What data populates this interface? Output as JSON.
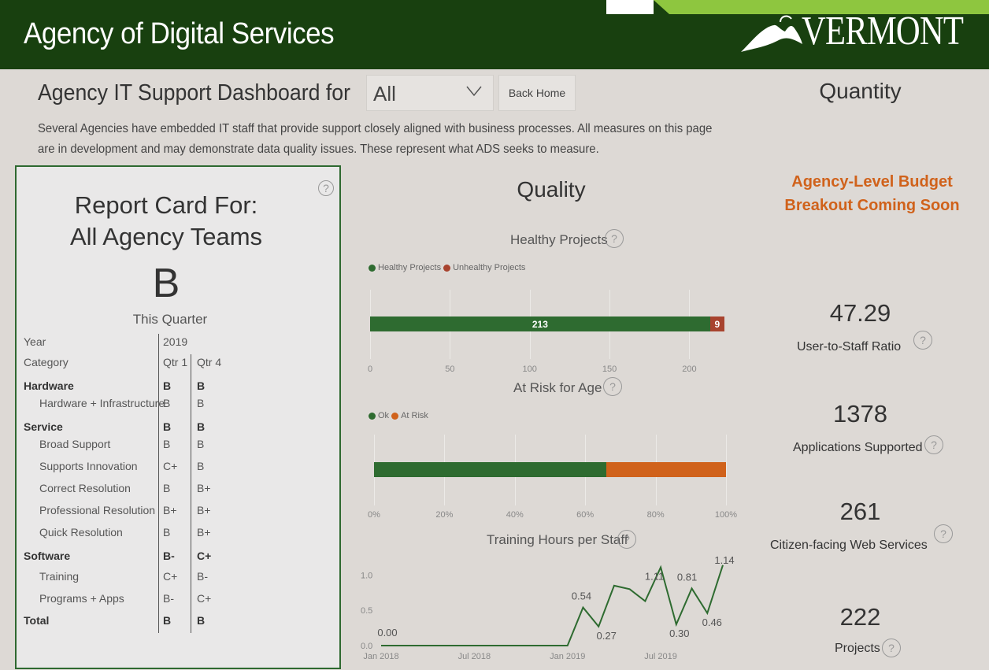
{
  "header": {
    "title": "Agency of Digital Services",
    "logo_text": "VERMONT"
  },
  "toolbar": {
    "dashboard_title": "Agency IT Support Dashboard for",
    "agency_select_value": "All",
    "back_button_label": "Back Home"
  },
  "description": "Several Agencies have embedded IT staff that provide support closely aligned with business processes. All measures on this page are in development and may demonstrate data quality issues. These represent what ADS seeks to measure.",
  "report_card": {
    "title_line1": "Report Card For:",
    "title_line2": "All Agency Teams",
    "grade": "B",
    "period_label": "This Quarter",
    "year_label": "Year",
    "year_value": "2019",
    "category_label": "Category",
    "quarters": [
      "Qtr 1",
      "Qtr 4"
    ],
    "rows": [
      {
        "name": "Hardware",
        "q1": "B",
        "q4": "B",
        "bold": true
      },
      {
        "name": "Hardware + Infrastructure",
        "q1": "B",
        "q4": "B",
        "bold": false
      },
      {
        "name": "Service",
        "q1": "B",
        "q4": "B",
        "bold": true
      },
      {
        "name": "Broad Support",
        "q1": "B",
        "q4": "B",
        "bold": false
      },
      {
        "name": "Supports Innovation",
        "q1": "C+",
        "q4": "B",
        "bold": false
      },
      {
        "name": "Correct Resolution",
        "q1": "B",
        "q4": "B+",
        "bold": false
      },
      {
        "name": "Professional Resolution",
        "q1": "B+",
        "q4": "B+",
        "bold": false
      },
      {
        "name": "Quick Resolution",
        "q1": "B",
        "q4": "B+",
        "bold": false
      },
      {
        "name": "Software",
        "q1": "B-",
        "q4": "C+",
        "bold": true
      },
      {
        "name": "Training",
        "q1": "C+",
        "q4": "B-",
        "bold": false
      },
      {
        "name": "Programs + Apps",
        "q1": "B-",
        "q4": "C+",
        "bold": false
      },
      {
        "name": "Total",
        "q1": "B",
        "q4": "B",
        "bold": true
      }
    ]
  },
  "quality": {
    "title": "Quality",
    "help_glyph": "?"
  },
  "chart_data": [
    {
      "type": "bar",
      "title": "Healthy Projects",
      "orientation": "horizontal-stacked",
      "series": [
        {
          "name": "Healthy Projects",
          "values": [
            213
          ],
          "color": "#2e6b30"
        },
        {
          "name": "Unhealthy Projects",
          "values": [
            9
          ],
          "color": "#a8432e"
        }
      ],
      "xlim": [
        0,
        222
      ],
      "ticks": [
        "0",
        "50",
        "100",
        "150",
        "200"
      ],
      "tick_values": [
        0,
        50,
        100,
        150,
        200
      ]
    },
    {
      "type": "bar",
      "title": "At Risk for Age",
      "orientation": "horizontal-100pct",
      "series": [
        {
          "name": "Ok",
          "values": [
            66
          ],
          "color": "#2e6b30"
        },
        {
          "name": "At Risk",
          "values": [
            34
          ],
          "color": "#d0621b"
        }
      ],
      "ticks": [
        "0%",
        "20%",
        "40%",
        "60%",
        "80%",
        "100%"
      ],
      "tick_values": [
        0,
        20,
        40,
        60,
        80,
        100
      ]
    },
    {
      "type": "line",
      "title": "Training Hours per Staff",
      "color": "#2e6b30",
      "x_ticks": [
        "Jan 2018",
        "Jul 2018",
        "Jan 2019",
        "Jul 2019"
      ],
      "y_ticks": [
        "0.0",
        "0.5",
        "1.0"
      ],
      "ylim": [
        0,
        1.25
      ],
      "points": [
        {
          "x": "Jan 2018",
          "y": 0.0,
          "label": "0.00"
        },
        {
          "x": "Feb 2018",
          "y": 0.0
        },
        {
          "x": "Mar 2018",
          "y": 0.0
        },
        {
          "x": "Apr 2018",
          "y": 0.0
        },
        {
          "x": "May 2018",
          "y": 0.0
        },
        {
          "x": "Jun 2018",
          "y": 0.0
        },
        {
          "x": "Jul 2018",
          "y": 0.0
        },
        {
          "x": "Aug 2018",
          "y": 0.0
        },
        {
          "x": "Sep 2018",
          "y": 0.0
        },
        {
          "x": "Oct 2018",
          "y": 0.0
        },
        {
          "x": "Nov 2018",
          "y": 0.0
        },
        {
          "x": "Dec 2018",
          "y": 0.0
        },
        {
          "x": "Jan 2019",
          "y": 0.0
        },
        {
          "x": "Feb 2019",
          "y": 0.54,
          "label": "0.54"
        },
        {
          "x": "Mar 2019",
          "y": 0.27,
          "label": "0.27"
        },
        {
          "x": "Apr 2019",
          "y": 0.85
        },
        {
          "x": "May 2019",
          "y": 0.8
        },
        {
          "x": "Jun 2019",
          "y": 0.63
        },
        {
          "x": "Jul 2019",
          "y": 1.11,
          "label": "1.11"
        },
        {
          "x": "Aug 2019",
          "y": 0.3,
          "label": "0.30"
        },
        {
          "x": "Sep 2019",
          "y": 0.81,
          "label": "0.81"
        },
        {
          "x": "Oct 2019",
          "y": 0.46,
          "label": "0.46"
        },
        {
          "x": "Nov 2019",
          "y": 1.14,
          "label": "1.14"
        }
      ]
    }
  ],
  "quantity": {
    "title": "Quantity",
    "budget_notice_line1": "Agency-Level Budget",
    "budget_notice_line2": "Breakout Coming Soon",
    "kpis": [
      {
        "value": "47.29",
        "label": "User-to-Staff Ratio"
      },
      {
        "value": "1378",
        "label": "Applications Supported"
      },
      {
        "value": "261",
        "label": "Citizen-facing Web Services"
      },
      {
        "value": "222",
        "label": "Projects"
      }
    ]
  }
}
